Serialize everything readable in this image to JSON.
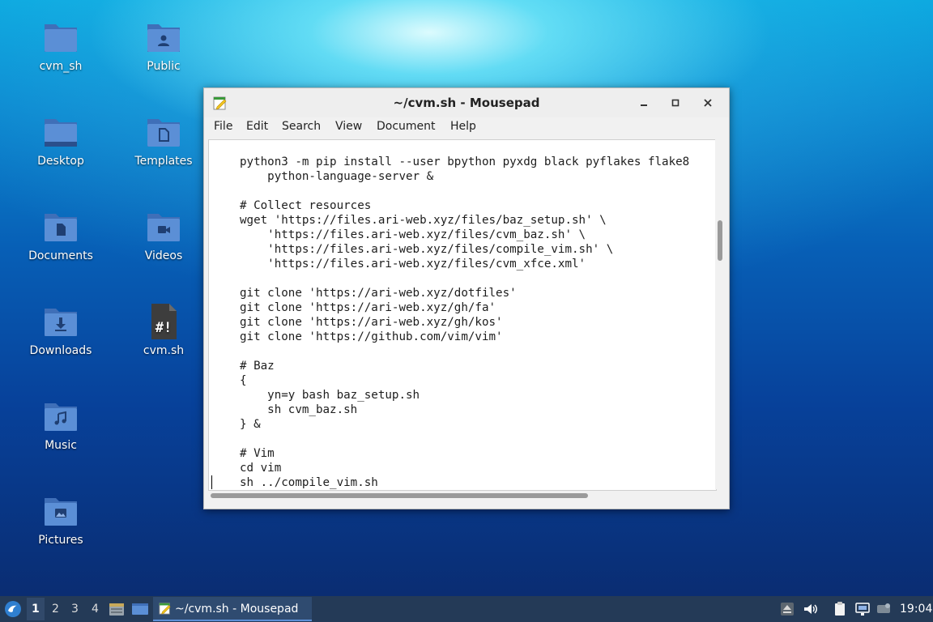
{
  "desktop": {
    "icons": [
      {
        "label": "cvm_sh",
        "icon": "folder-icon"
      },
      {
        "label": "Public",
        "icon": "folder-public-icon"
      },
      {
        "label": "Desktop",
        "icon": "folder-desktop-icon"
      },
      {
        "label": "Templates",
        "icon": "folder-templates-icon"
      },
      {
        "label": "Documents",
        "icon": "folder-documents-icon"
      },
      {
        "label": "Videos",
        "icon": "folder-videos-icon"
      },
      {
        "label": "Downloads",
        "icon": "folder-downloads-icon"
      },
      {
        "label": "cvm.sh",
        "icon": "shell-script-file-icon"
      },
      {
        "label": "Music",
        "icon": "folder-music-icon"
      },
      {
        "label": "Pictures",
        "icon": "folder-pictures-icon"
      }
    ]
  },
  "window": {
    "title": "~/cvm.sh - Mousepad",
    "menu": [
      "File",
      "Edit",
      "Search",
      "View",
      "Document",
      "Help"
    ],
    "editor_text": "python3 -m pip install --user bpython pyxdg black pyflakes flake8\n    python-language-server &\n\n# Collect resources\nwget 'https://files.ari-web.xyz/files/baz_setup.sh' \\\n    'https://files.ari-web.xyz/files/cvm_baz.sh' \\\n    'https://files.ari-web.xyz/files/compile_vim.sh' \\\n    'https://files.ari-web.xyz/files/cvm_xfce.xml'\n\ngit clone 'https://ari-web.xyz/dotfiles'\ngit clone 'https://ari-web.xyz/gh/fa'\ngit clone 'https://ari-web.xyz/gh/kos'\ngit clone 'https://github.com/vim/vim'\n\n# Baz\n{\n    yn=y bash baz_setup.sh\n    sh cvm_baz.sh\n} &\n\n# Vim\ncd vim\nsh ../compile_vim.sh"
  },
  "taskbar": {
    "workspaces": [
      "1",
      "2",
      "3",
      "4"
    ],
    "active_workspace": "1",
    "task_label": "~/cvm.sh - Mousepad",
    "clock": "19:04"
  },
  "colors": {
    "folder": "#5b8fd6",
    "folder_dark": "#3f6fb8",
    "taskbar": "#243a57"
  }
}
